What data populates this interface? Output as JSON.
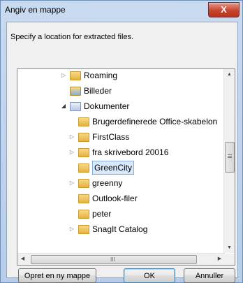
{
  "window": {
    "title": "Angiv en mappe",
    "close_label": "X"
  },
  "dialog": {
    "instruction": "Specify a location for extracted files."
  },
  "tree": {
    "items": [
      {
        "label": "Roaming",
        "expander": "collapsed",
        "icon": "folder-icon"
      },
      {
        "label": "Billeder",
        "expander": "none",
        "icon": "pictures-library-icon"
      },
      {
        "label": "Dokumenter",
        "expander": "expanded",
        "icon": "documents-library-icon"
      },
      {
        "label": "Brugerdefinerede Office-skabelon",
        "expander": "none",
        "icon": "folder-icon"
      },
      {
        "label": "FirstClass",
        "expander": "collapsed",
        "icon": "folder-icon"
      },
      {
        "label": "fra skrivebord 20016",
        "expander": "collapsed",
        "icon": "folder-icon"
      },
      {
        "label": "GreenCity",
        "expander": "none",
        "icon": "folder-icon",
        "selected": true
      },
      {
        "label": "greenny",
        "expander": "collapsed",
        "icon": "folder-icon"
      },
      {
        "label": "Outlook-filer",
        "expander": "none",
        "icon": "folder-icon"
      },
      {
        "label": "peter",
        "expander": "none",
        "icon": "folder-icon"
      },
      {
        "label": "SnagIt Catalog",
        "expander": "collapsed",
        "icon": "folder-icon"
      }
    ],
    "hscroll_grip": "III"
  },
  "buttons": {
    "new_folder": "Opret en ny mappe",
    "ok": "OK",
    "cancel": "Annuller"
  }
}
